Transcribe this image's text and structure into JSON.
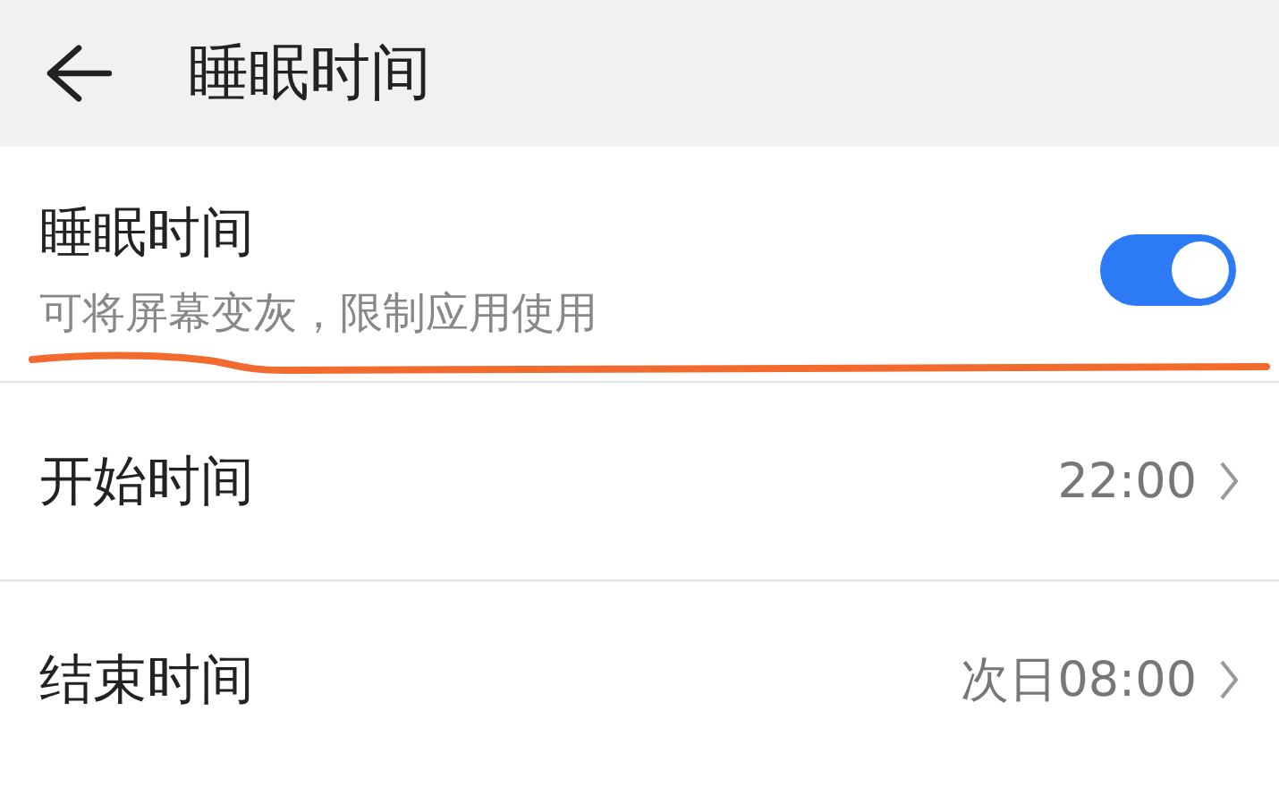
{
  "header": {
    "title": "睡眠时间"
  },
  "settings": [
    {
      "kind": "toggle",
      "title": "睡眠时间",
      "subtitle": "可将屏幕变灰，限制应用使用",
      "on": true
    },
    {
      "kind": "value",
      "title": "开始时间",
      "value": "22:00"
    },
    {
      "kind": "value",
      "title": "结束时间",
      "value": "次日08:00"
    }
  ]
}
